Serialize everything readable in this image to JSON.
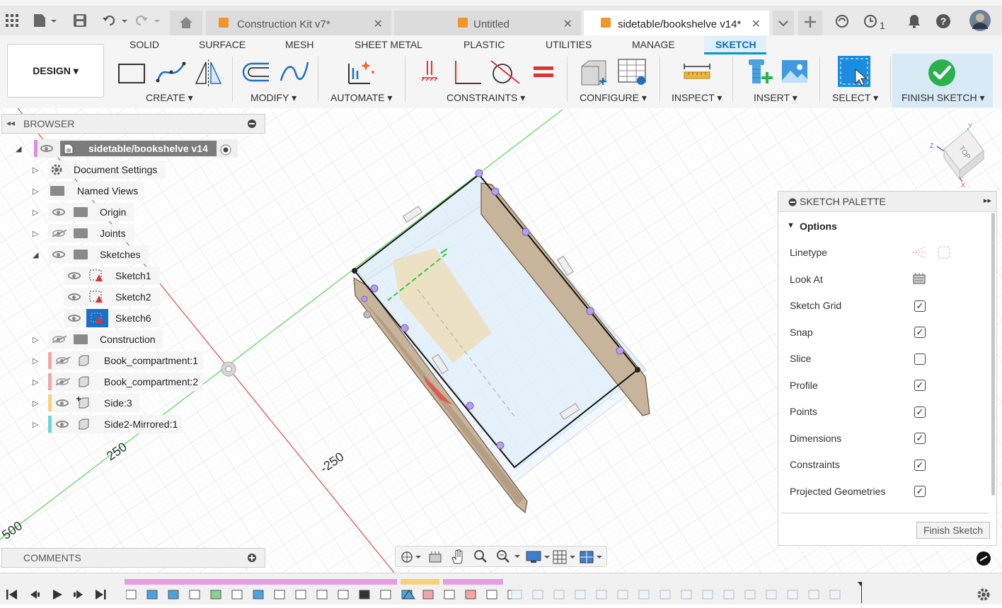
{
  "tabs": [
    {
      "label": "Construction Kit v7*",
      "active": false
    },
    {
      "label": "Untitled",
      "active": false
    },
    {
      "label": "sidetable/bookshelve v14*",
      "active": true
    }
  ],
  "topbar": {
    "job_count": "1"
  },
  "ribbon": {
    "design_label": "DESIGN",
    "tabs": [
      "SOLID",
      "SURFACE",
      "MESH",
      "SHEET METAL",
      "PLASTIC",
      "UTILITIES",
      "MANAGE",
      "SKETCH"
    ],
    "active_tab": "SKETCH",
    "groups": [
      "CREATE",
      "MODIFY",
      "AUTOMATE",
      "CONSTRAINTS",
      "CONFIGURE",
      "INSPECT",
      "INSERT",
      "SELECT",
      "FINISH SKETCH"
    ]
  },
  "browser": {
    "title": "BROWSER",
    "root": "sidetable/bookshelve v14",
    "items": [
      {
        "label": "Document Settings",
        "icon": "gear-icon"
      },
      {
        "label": "Named Views",
        "icon": "folder-icon"
      },
      {
        "label": "Origin",
        "icon": "folder-icon"
      },
      {
        "label": "Joints",
        "icon": "folder-icon"
      },
      {
        "label": "Sketches",
        "icon": "folder-icon"
      },
      {
        "label": "Sketch1",
        "icon": "sketch-icon"
      },
      {
        "label": "Sketch2",
        "icon": "sketch-icon"
      },
      {
        "label": "Sketch6",
        "icon": "sketch-active-icon"
      },
      {
        "label": "Construction",
        "icon": "folder-icon"
      },
      {
        "label": "Book_compartment:1",
        "icon": "component-icon",
        "color": "#f4a6a6"
      },
      {
        "label": "Book_compartment:2",
        "icon": "component-icon",
        "color": "#f4a6a6"
      },
      {
        "label": "Side:3",
        "icon": "component-grounded-icon",
        "color": "#f7d27c"
      },
      {
        "label": "Side2-Mirrored:1",
        "icon": "component-icon",
        "color": "#6cd7d7"
      }
    ]
  },
  "comments": {
    "title": "COMMENTS"
  },
  "canvas": {
    "labels": [
      "250",
      "-250",
      "500"
    ],
    "viewcube_face": "TOP"
  },
  "palette": {
    "title": "SKETCH PALETTE",
    "section": "Options",
    "rows": [
      {
        "label": "Linetype",
        "kind": "icon"
      },
      {
        "label": "Look At",
        "kind": "icon"
      },
      {
        "label": "Sketch Grid",
        "checked": true
      },
      {
        "label": "Snap",
        "checked": true
      },
      {
        "label": "Slice",
        "checked": false
      },
      {
        "label": "Profile",
        "checked": true
      },
      {
        "label": "Points",
        "checked": true
      },
      {
        "label": "Dimensions",
        "checked": true
      },
      {
        "label": "Constraints",
        "checked": true
      },
      {
        "label": "Projected Geometries",
        "checked": true
      }
    ],
    "finish_button": "Finish Sketch"
  },
  "colors": {
    "accent": "#0696d7",
    "finish_green": "#2bb24c",
    "active_sketch": "#1b6fc4"
  }
}
